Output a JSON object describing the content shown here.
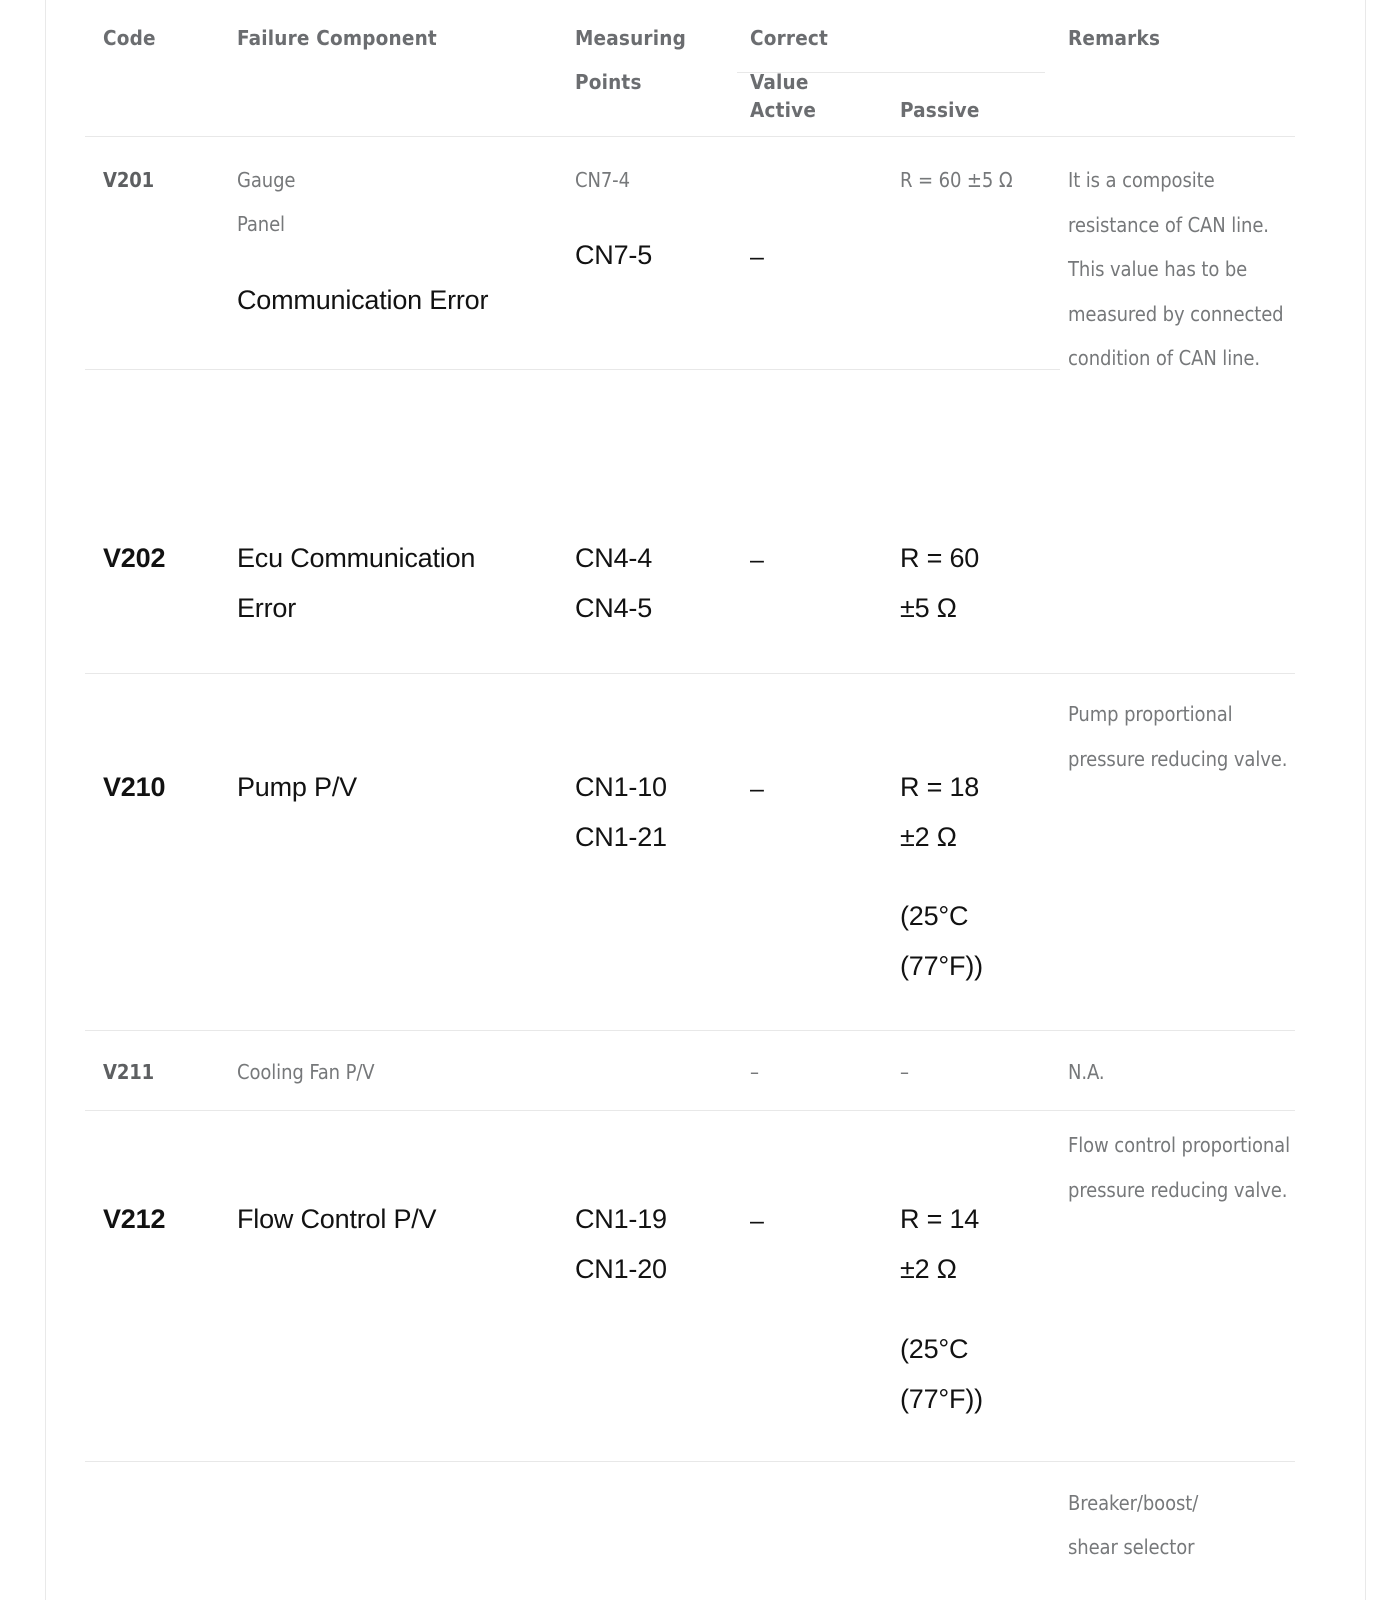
{
  "table": {
    "headers": {
      "code": "Code",
      "failure_component": "Failure Component",
      "measuring_points_line1": "Measuring",
      "measuring_points_line2": "Points",
      "correct_value": "Correct Value",
      "active": "Active",
      "passive": "Passive",
      "remarks": "Remarks"
    },
    "rows": [
      {
        "code": "V201",
        "component_src_line1": "Gauge",
        "component_src_line2": "Panel",
        "component_overlay": "Communication Error",
        "measuring_src": "CN7-4",
        "measuring_overlay": "CN7-5",
        "active": "–",
        "passive_src": "R = 60 ±5 Ω",
        "remarks": "It is a composite resistance of CAN line. This value has to be measured by connected condition of CAN line."
      },
      {
        "code": "V202",
        "component_line1": "Ecu Communication",
        "component_line2": "Error",
        "measuring_line1": "CN4-4",
        "measuring_line2": "CN4-5",
        "active": "–",
        "passive_line1": "R = 60",
        "passive_line2": "±5 Ω",
        "remarks": ""
      },
      {
        "code": "V210",
        "component_line1": "Pump P/V",
        "measuring_line1": "CN1-10",
        "measuring_line2": "CN1-21",
        "active": "–",
        "passive_line1": "R = 18",
        "passive_line2": "±2 Ω",
        "passive_line3": "(25°C",
        "passive_line4": "(77°F))",
        "remarks": "Pump proportional pressure reducing valve."
      },
      {
        "code": "V211",
        "component_line1": "Cooling Fan P/V",
        "measuring_line1": "",
        "active": "–",
        "passive_line1": "–",
        "remarks": "N.A."
      },
      {
        "code": "V212",
        "component_line1": "Flow Control P/V",
        "measuring_line1": "CN1-19",
        "measuring_line2": "CN1-20",
        "active": "–",
        "passive_line1": "R = 14",
        "passive_line2": "±2 Ω",
        "passive_line3": "(25°C",
        "passive_line4": "(77°F))",
        "remarks": "Flow control proportional pressure reducing valve."
      },
      {
        "code": "",
        "component_line1": "",
        "remarks_line1": "Breaker/boost/",
        "remarks_line2": "shear selector"
      }
    ]
  },
  "colors": {
    "source_text": "#76787a",
    "overlay_text": "#121212",
    "rule": "#e8e8e8",
    "page_rule": "#e9e9e9",
    "background": "#ffffff"
  }
}
